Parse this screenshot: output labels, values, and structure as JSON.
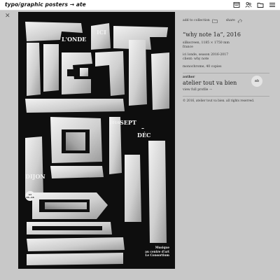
{
  "header": {
    "breadcrumb": "typo/graphic posters → ate"
  },
  "poster": {
    "ici": "ICI",
    "londe": "L'ONDE",
    "year": "2016",
    "sept": "SEPT",
    "dash": "–",
    "dec": "DÉC",
    "dijon": "DIJON",
    "badge_top": "ici",
    "badge_bottom": "15—16",
    "footer_line1": "Musique",
    "footer_line2": "au centre d'art",
    "footer_line3": "Le Consortium"
  },
  "panel": {
    "add_to_collection": "add to collection",
    "share": "share",
    "title": "“why note 1a”, 2016",
    "tech_line1": "silkscreen, 1185 × 1750 mm",
    "tech_line2": "france",
    "client_line1": "ici londe, season 2016-2017",
    "client_line2": "client: why note",
    "print_info": "monochrome, 40 copies",
    "author_label": "author",
    "author_name": "atelier tout va bien",
    "view_profile": "view full profile →",
    "copyright": "© 2016, atelier tout va bien. all rights reserved.",
    "avatar_initials": "ab"
  }
}
